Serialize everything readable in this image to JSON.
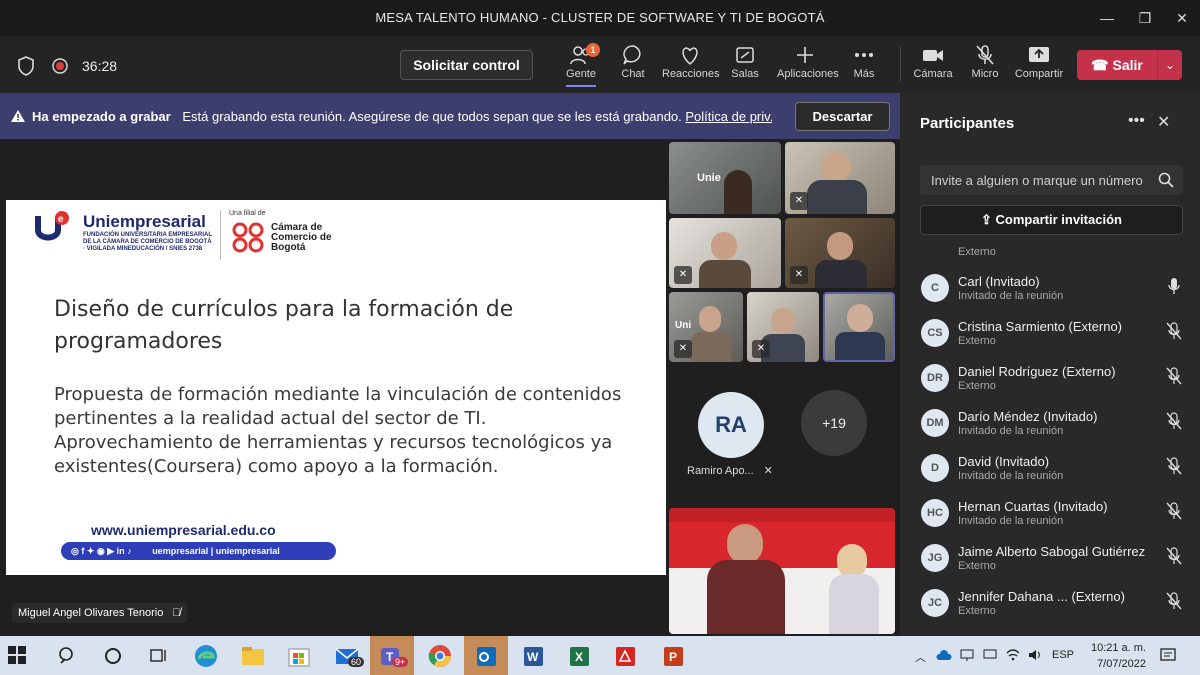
{
  "window": {
    "title": "MESA TALENTO HUMANO - CLUSTER DE SOFTWARE Y TI DE BOGOTÁ"
  },
  "toolbar": {
    "timer": "36:28",
    "control_label": "Solicitar control",
    "people_badge": "1",
    "buttons": [
      {
        "label": "Gente",
        "icon": "people-icon"
      },
      {
        "label": "Chat",
        "icon": "chat-icon"
      },
      {
        "label": "Reacciones",
        "icon": "reactions-icon"
      },
      {
        "label": "Salas",
        "icon": "rooms-icon"
      },
      {
        "label": "Aplicaciones",
        "icon": "plus-icon"
      },
      {
        "label": "Más",
        "icon": "more-icon"
      },
      {
        "label": "Cámara",
        "icon": "camera-icon"
      },
      {
        "label": "Micro",
        "icon": "mic-off-icon"
      },
      {
        "label": "Compartir",
        "icon": "share-icon"
      }
    ],
    "leave_label": "Salir"
  },
  "banner": {
    "bold": "Ha empezado a grabar",
    "text": "Está grabando esta reunión. Asegúrese de que todos sepan que se les está grabando.",
    "link": "Política de priv...",
    "discard_label": "Descartar"
  },
  "slide": {
    "brand": "Uniempresarial",
    "brand_sub": "FUNDACIÓN UNIVERSITARIA EMPRESARIAL DE LA CÁMARA DE COMERCIO DE BOGOTÁ · VIGILADA MINEDUCACIÓN / SNIES 2738",
    "filial": "Una filial de",
    "ccb": "Cámara de Comercio de Bogotá",
    "title": "Diseño de currículos para la formación de programadores",
    "body": "Propuesta de formación mediante la vinculación de contenidos pertinentes a la realidad actual del sector de TI. Aprovechamiento de herramientas y recursos tecnológicos ya existentes(Coursera) como apoyo a la formación.",
    "url": "www.uniempresarial.edu.co",
    "social": "uempresarial | uniempresarial"
  },
  "presenter_name": "Miguel Angel Olivares Tenorio",
  "gallery": {
    "ra_initials": "RA",
    "ra_name": "Ramiro Apo...",
    "more_count": "+19"
  },
  "panel": {
    "title": "Participantes",
    "invite_placeholder": "Invite a alguien o marque un número",
    "share_invite": "Compartir invitación",
    "top_partial_role": "Externo",
    "participants": [
      {
        "initials": "C",
        "name": "Carl (Invitado)",
        "role": "Invitado de la reunión",
        "mic": "on"
      },
      {
        "initials": "CS",
        "name": "Cristina Sarmiento (Externo)",
        "role": "Externo",
        "mic": "off"
      },
      {
        "initials": "DR",
        "name": "Daniel Rodríguez (Externo)",
        "role": "Externo",
        "mic": "off"
      },
      {
        "initials": "DM",
        "name": "Darío Méndez (Invitado)",
        "role": "Invitado de la reunión",
        "mic": "off"
      },
      {
        "initials": "D",
        "name": "David (Invitado)",
        "role": "Invitado de la reunión",
        "mic": "off"
      },
      {
        "initials": "HC",
        "name": "Hernan Cuartas (Invitado)",
        "role": "Invitado de la reunión",
        "mic": "off"
      },
      {
        "initials": "JG",
        "name": "Jaime Alberto Sabogal Gutiérrez",
        "role": "Externo",
        "mic": "off"
      },
      {
        "initials": "JC",
        "name": "Jennifer Dahana ... (Externo)",
        "role": "Externo",
        "mic": "off"
      }
    ]
  },
  "taskbar": {
    "mail_badge": "60",
    "teams_badge": "9+",
    "lang": "ESP",
    "time": "10:21 a. m.",
    "date": "7/07/2022"
  }
}
